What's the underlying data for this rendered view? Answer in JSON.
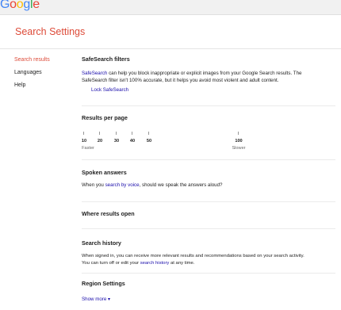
{
  "logo": {
    "letters": [
      "G",
      "o",
      "o",
      "g",
      "l",
      "e"
    ],
    "colors": [
      "#4285f4",
      "#ea4335",
      "#fbbc05",
      "#4285f4",
      "#34a853",
      "#ea4335"
    ]
  },
  "page_title": "Search Settings",
  "sidebar": {
    "items": [
      {
        "label": "Search results",
        "active": true
      },
      {
        "label": "Languages",
        "active": false
      },
      {
        "label": "Help",
        "active": false
      }
    ]
  },
  "safesearch": {
    "title": "SafeSearch filters",
    "link_text": "SafeSearch",
    "text_1": " can help you block inappropriate or explicit images from your Google Search results. The",
    "text_2": "SafeSearch filter isn't 100% accurate, but it helps you avoid most violent and adult content.",
    "lock_link": "Lock SafeSearch"
  },
  "results_per_page": {
    "title": "Results per page",
    "ticks": [
      "10",
      "20",
      "30",
      "40",
      "50",
      "100"
    ],
    "faster": "Faster",
    "slower": "Slower"
  },
  "spoken": {
    "title": "Spoken answers",
    "pre": "When you ",
    "link": "search by voice",
    "post": ", should we speak the answers aloud?"
  },
  "where_results": {
    "title": "Where results open"
  },
  "history": {
    "title": "Search history",
    "line1": "When signed in, you can receive more relevant results and recommendations based on your search activity.",
    "line2_pre": "You can turn off or edit your ",
    "line2_link": "search history",
    "line2_post": " at any time."
  },
  "region": {
    "title": "Region Settings",
    "show_more": "Show more ▾"
  },
  "accent": {
    "red": "#dd4b39",
    "link": "#1a0dab"
  }
}
